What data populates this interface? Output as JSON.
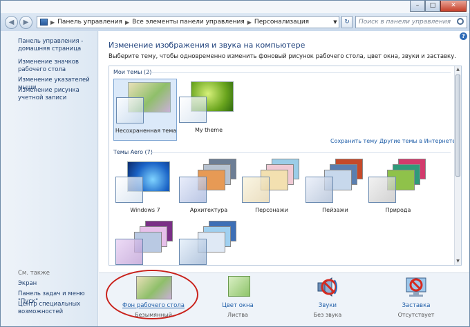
{
  "address": {
    "crumbs": [
      "Панель управления",
      "Все элементы панели управления",
      "Персонализация"
    ],
    "search_placeholder": "Поиск в панели управления"
  },
  "left_pane": {
    "links": [
      "Панель управления - домашняя страница",
      "Изменение значков рабочего стола",
      "Изменение указателей мыши",
      "Изменение рисунка учетной записи"
    ],
    "see_also_heading": "См. также",
    "see_also": [
      "Экран",
      "Панель задач и меню \"Пуск\"",
      "Центр специальных возможностей"
    ]
  },
  "main": {
    "title": "Изменение изображения и звука на компьютере",
    "description": "Выберите тему, чтобы одновременно изменить фоновый рисунок рабочего стола, цвет окна, звуки и заставку.",
    "my_themes_label": "Мои темы (2)",
    "my_themes": [
      {
        "label": "Несохраненная тема",
        "selected": true
      },
      {
        "label": "My theme",
        "selected": false
      }
    ],
    "save_theme_link": "Сохранить тему",
    "online_themes_link": "Другие темы в Интернете",
    "aero_label": "Темы Aero (7)",
    "aero_themes": [
      "Windows 7",
      "Архитектура",
      "Персонажи",
      "Пейзажи",
      "Природа",
      "",
      ""
    ]
  },
  "bottom": [
    {
      "title": "Фон рабочего стола",
      "subtitle": "Безымянный",
      "icon": "desktop-background-icon"
    },
    {
      "title": "Цвет окна",
      "subtitle": "Листва",
      "icon": "window-color-icon"
    },
    {
      "title": "Звуки",
      "subtitle": "Без звука",
      "icon": "sounds-icon"
    },
    {
      "title": "Заставка",
      "subtitle": "Отсутствует",
      "icon": "screensaver-icon"
    }
  ],
  "colors": {
    "accent": "#1f5ea8",
    "link": "#1f3f6e",
    "highlight": "#c9221c"
  }
}
